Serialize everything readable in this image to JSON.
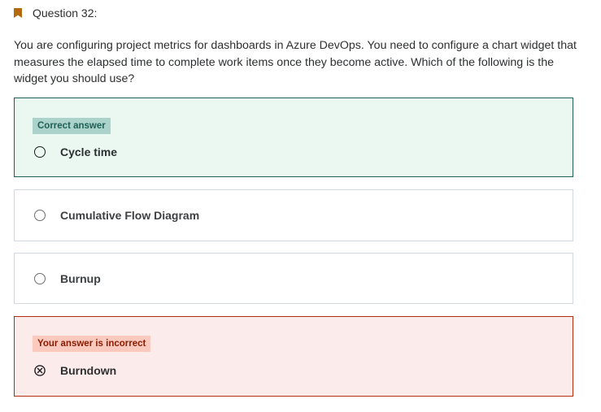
{
  "question": {
    "label": "Question 32:",
    "text": "You are configuring project metrics for dashboards in Azure DevOps. You need to configure a chart widget that measures the elapsed time to complete work items once they become active. Which of the following is the widget you should use?",
    "bookmark_icon": "bookmark-icon",
    "bookmark_color": "#b4690e"
  },
  "options": [
    {
      "label": "Cycle time",
      "state": "correct",
      "badge": "Correct answer"
    },
    {
      "label": "Cumulative Flow Diagram",
      "state": "neutral"
    },
    {
      "label": "Burnup",
      "state": "neutral"
    },
    {
      "label": "Burndown",
      "state": "incorrect",
      "badge": "Your answer is incorrect",
      "icon": "x-circle-icon"
    }
  ],
  "colors": {
    "correct_bg": "#ebf8f2",
    "correct_border": "#1e6055",
    "incorrect_bg": "#fcebeb",
    "incorrect_border": "#b32d0f"
  }
}
